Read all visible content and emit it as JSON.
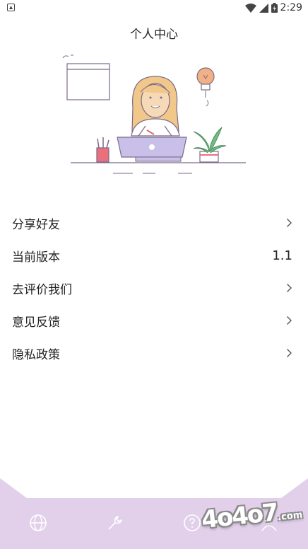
{
  "status_bar": {
    "time": "2:29"
  },
  "header": {
    "title": "个人中心"
  },
  "menu": {
    "items": [
      {
        "label": "分享好友",
        "value": ""
      },
      {
        "label": "当前版本",
        "value": "1.1"
      },
      {
        "label": "去评价我们",
        "value": ""
      },
      {
        "label": "意见反馈",
        "value": ""
      },
      {
        "label": "隐私政策",
        "value": ""
      }
    ]
  },
  "bottom_nav": {
    "icons": [
      "globe-icon",
      "wrench-icon",
      "help-icon",
      "user-icon"
    ]
  },
  "watermark": {
    "main": "4o4o7",
    "sub": ".com"
  },
  "colors": {
    "accent_lavender": "#e2d0ea",
    "text": "#222222",
    "nav_icon": "#ffffff"
  }
}
